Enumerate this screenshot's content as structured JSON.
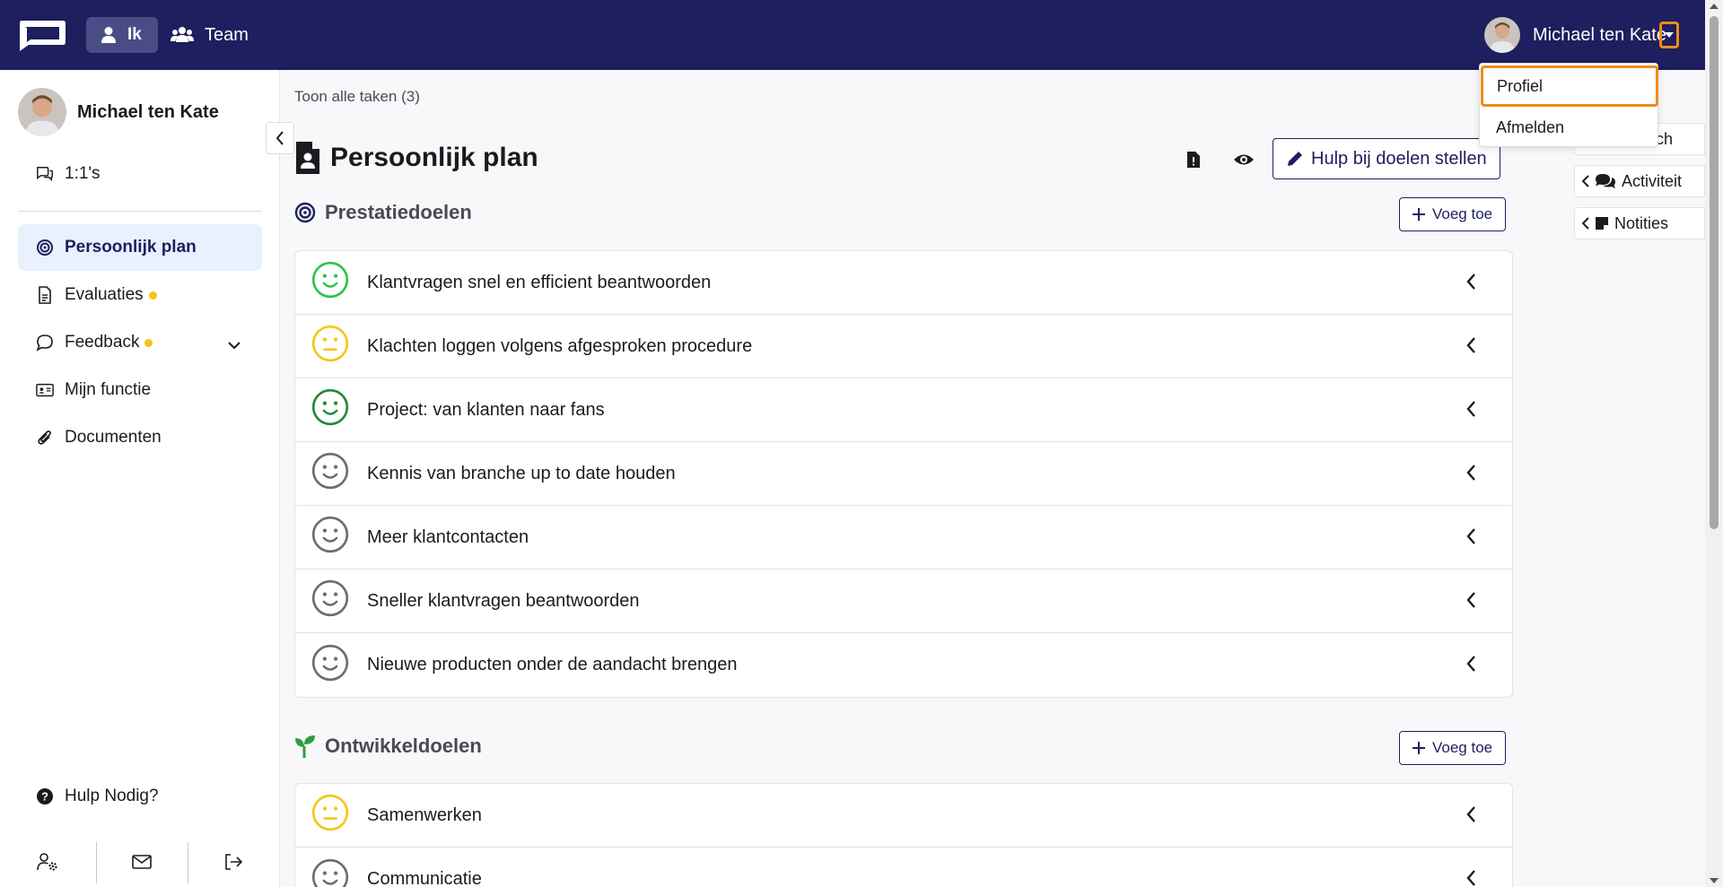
{
  "topbar": {
    "nav_me": "Ik",
    "nav_team": "Team",
    "user_name": "Michael ten Kate"
  },
  "user_menu": {
    "items": [
      {
        "label": "Profiel"
      },
      {
        "label": "Afmelden"
      }
    ]
  },
  "sidebar": {
    "user_name": "Michael ten Kate",
    "items": [
      {
        "label": "1:1's",
        "icon": "chat-bubbles-icon"
      },
      {
        "label": "Persoonlijk plan",
        "icon": "target-icon",
        "active": true
      },
      {
        "label": "Evaluaties",
        "icon": "document-icon",
        "badge": true
      },
      {
        "label": "Feedback",
        "icon": "chat-bubble-icon",
        "badge": true
      },
      {
        "label": "Mijn functie",
        "icon": "id-card-icon"
      },
      {
        "label": "Documenten",
        "icon": "paperclip-icon"
      }
    ],
    "help_label": "Hulp Nodig?"
  },
  "main": {
    "show_all": "Toon alle taken (3)",
    "plan_title": "Persoonlijk plan",
    "help_goals_button": "Hulp bij doelen stellen",
    "sections": [
      {
        "title": "Prestatiedoelen",
        "add_label": "Voeg toe",
        "goals": [
          {
            "label": "Klantvragen snel en efficient beantwoorden",
            "mood": "happy",
            "color": "#2ec24a"
          },
          {
            "label": "Klachten loggen volgens afgesproken procedure",
            "mood": "neutral",
            "color": "#f5c518"
          },
          {
            "label": "Project: van klanten naar fans",
            "mood": "happy",
            "color": "#1e8a3a"
          },
          {
            "label": "Kennis van branche up to date houden",
            "mood": "happy",
            "color": "#6b6b72"
          },
          {
            "label": "Meer klantcontacten",
            "mood": "happy",
            "color": "#6b6b72"
          },
          {
            "label": "Sneller klantvragen beantwoorden",
            "mood": "happy",
            "color": "#6b6b72"
          },
          {
            "label": "Nieuwe producten onder de aandacht brengen",
            "mood": "happy",
            "color": "#6b6b72"
          }
        ]
      },
      {
        "title": "Ontwikkeldoelen",
        "add_label": "Voeg toe",
        "goals": [
          {
            "label": "Samenwerken",
            "mood": "neutral",
            "color": "#f5c518"
          },
          {
            "label": "Communicatie",
            "mood": "happy",
            "color": "#6b6b72"
          }
        ]
      }
    ]
  },
  "right_panels": {
    "coach": "ach",
    "activity": "Activiteit",
    "notes": "Notities"
  },
  "colors": {
    "topbar": "#1d1f5e",
    "accent_highlight": "#f08c1a",
    "active_bg": "#e8f1fd",
    "badge": "#f5c518"
  }
}
